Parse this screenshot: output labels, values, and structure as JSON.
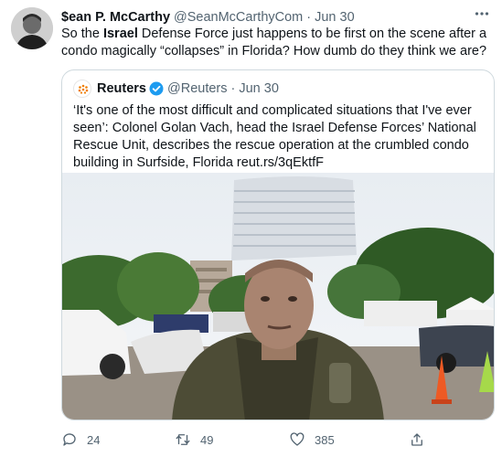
{
  "tweet": {
    "author_name": "$ean P. McCarthy",
    "author_handle": "@SeanMcCarthyCom",
    "separator": "·",
    "date": "Jun 30",
    "text_before": "So the ",
    "text_bold": "Israel",
    "text_after": " Defense Force just happens to be first on the scene after a condo magically “collapses” in Florida? How dumb do they think we are?",
    "more_icon": "more-dots-icon"
  },
  "quoted": {
    "author_name": "Reuters",
    "author_handle": "@Reuters",
    "separator": "·",
    "date": "Jun 30",
    "text": "‘It's one of the most difficult and complicated situations that I've ever seen’: Colonel Golan Vach, head the Israel Defense Forces’ National Rescue Unit, describes the rescue operation at the crumbled condo building in Surfside, Florida reut.rs/3qEktfF",
    "verified_color": "#1d9bf0"
  },
  "actions": {
    "reply_count": "24",
    "retweet_count": "49",
    "like_count": "385"
  },
  "colors": {
    "text": "#0f1419",
    "secondary": "#536471",
    "border": "#cfd9de"
  }
}
